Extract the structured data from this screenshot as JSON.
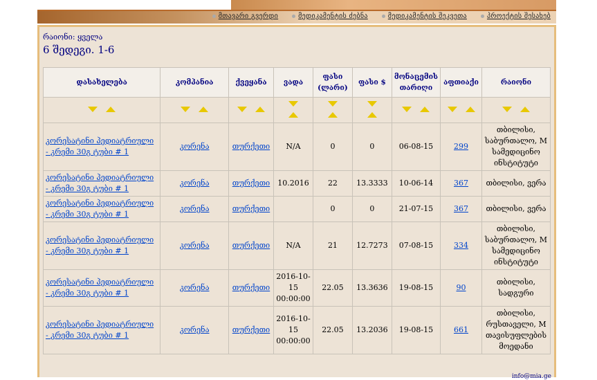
{
  "nav": [
    "მთავარი გვერდი",
    "მედიკამენტის ძებნა",
    "მედიკამენტის შეკვეთა",
    "პროექტის შესახებ"
  ],
  "district_filter": "რაიონი: ყველა",
  "results_count": "6 შედეგი. 1-6",
  "columns": [
    "დასახელება",
    "კომპანია",
    "ქვეყანა",
    "ვადა",
    "ფასი (ლარი)",
    "ფასი $",
    "მონაცემის თარიღი",
    "აფთიაქი",
    "რაიონი"
  ],
  "rows": [
    {
      "name": "კორესატინი პედიატრიული - კრემი 30გ ტუბი # 1",
      "company": "კორენა",
      "country": "თურქეთი",
      "expiry": "N/A",
      "price_gel": "0",
      "price_usd": "0",
      "date": "06-08-15",
      "pharmacy": "299",
      "district": "თბილისი, საბურთალო, M სამედიცინო ინსტიტუტი"
    },
    {
      "name": "კორესატინი პედიატრიული - კრემი 30გ ტუბი # 1",
      "company": "კორენა",
      "country": "თურქეთი",
      "expiry": "10.2016",
      "price_gel": "22",
      "price_usd": "13.3333",
      "date": "10-06-14",
      "pharmacy": "367",
      "district": "თბილისი, ვერა"
    },
    {
      "name": "კორესატინი პედიატრიული - კრემი 30გ ტუბი # 1",
      "company": "კორენა",
      "country": "თურქეთი",
      "expiry": "",
      "price_gel": "0",
      "price_usd": "0",
      "date": "21-07-15",
      "pharmacy": "367",
      "district": "თბილისი, ვერა"
    },
    {
      "name": "კორესატინი პედიატრიული - კრემი 30გ ტუბი # 1",
      "company": "კორენა",
      "country": "თურქეთი",
      "expiry": "N/A",
      "price_gel": "21",
      "price_usd": "12.7273",
      "date": "07-08-15",
      "pharmacy": "334",
      "district": "თბილისი, საბურთალო, M სამედიცინო ინსტიტუტი"
    },
    {
      "name": "კორესატინი პედიატრიული - კრემი 30გ ტუბი # 1",
      "company": "კორენა",
      "country": "თურქეთი",
      "expiry": "2016-10-15 00:00:00",
      "price_gel": "22.05",
      "price_usd": "13.3636",
      "date": "19-08-15",
      "pharmacy": "90",
      "district": "თბილისი, სადგური"
    },
    {
      "name": "კორესატინი პედიატრიული - კრემი 30გ ტუბი # 1",
      "company": "კორენა",
      "country": "თურქეთი",
      "expiry": "2016-10-15 00:00:00",
      "price_gel": "22.05",
      "price_usd": "13.2036",
      "date": "19-08-15",
      "pharmacy": "661",
      "district": "თბილისი, რუსთაველი, M თავისუფლების მოედანი"
    }
  ],
  "footer": "info@mia.ge"
}
